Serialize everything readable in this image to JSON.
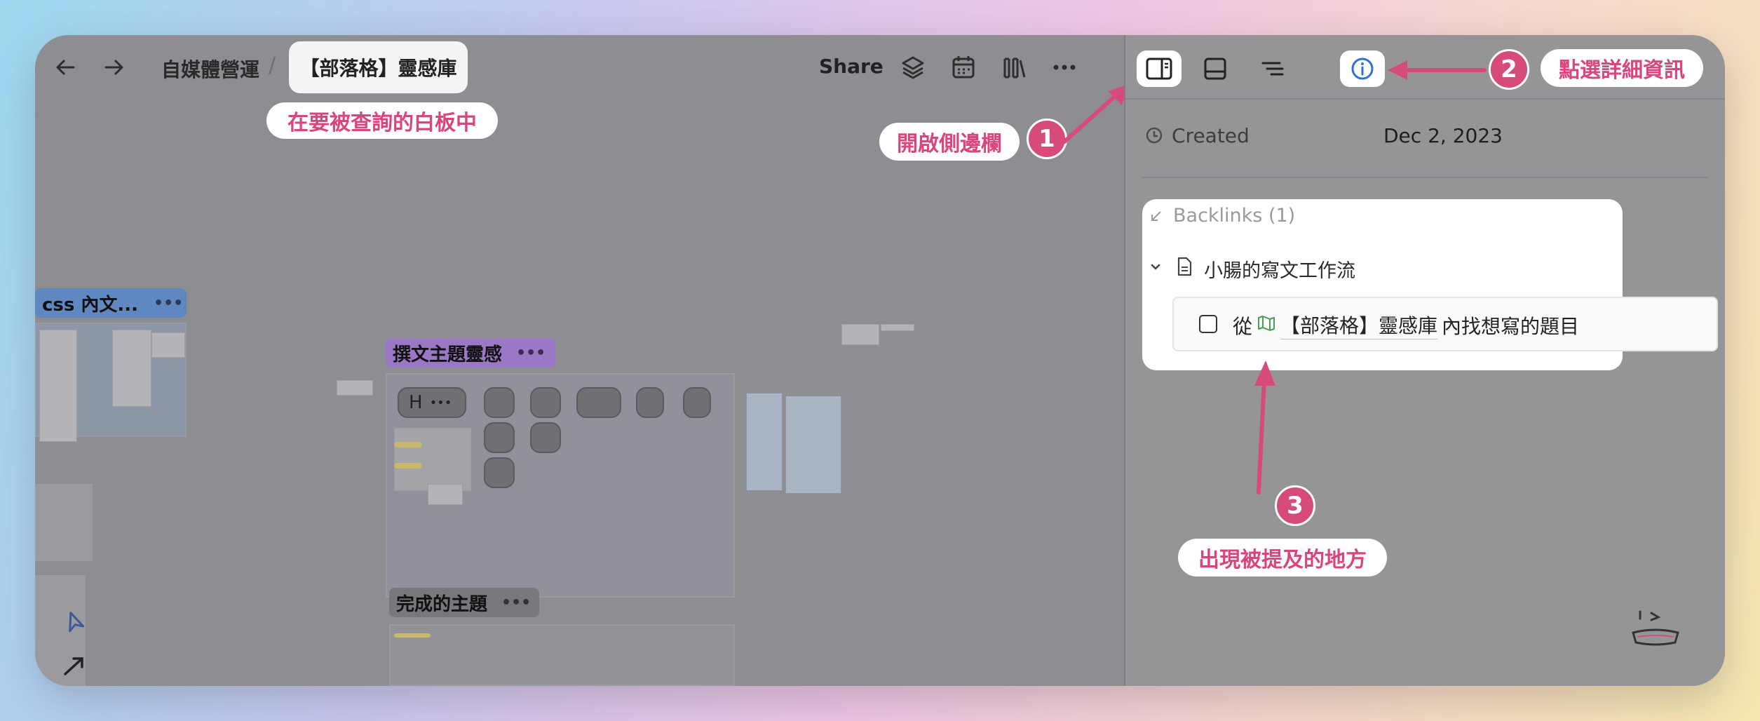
{
  "nav": {
    "back_icon": "arrow-left-icon",
    "forward_icon": "arrow-right-icon"
  },
  "breadcrumb": {
    "parent": "自媒體營運",
    "separator": "/",
    "current": "【部落格】靈感庫"
  },
  "toolbar": {
    "share_label": "Share",
    "icons": [
      "layers-icon",
      "calendar-icon",
      "library-icon",
      "more-icon"
    ]
  },
  "side_toolbar": {
    "icons": [
      "sidebar-toggle-icon",
      "panel-icon",
      "outline-icon",
      "info-icon"
    ]
  },
  "annotations": {
    "step1_number": "1",
    "step1_label": "開啟側邊欄",
    "step2_number": "2",
    "step2_label": "點選詳細資訊",
    "step3_number": "3",
    "step3_label": "出現被提及的地方",
    "whiteboard_hint": "在要被查詢的白板中",
    "accent_color": "#d64a7c"
  },
  "canvas": {
    "group1_label": "css 內文...",
    "group1_dots": "•••",
    "group2_label": "撰文主題靈感",
    "group2_dots": "•••",
    "group3_label": "完成的主題",
    "group3_dots": "•••",
    "node_letter": "H",
    "node_dots": "•••"
  },
  "details": {
    "created_label": "Created",
    "created_value": "Dec 2, 2023",
    "backlinks_label": "Backlinks (1)",
    "backlink_doc_title": "小腸的寫文工作流",
    "todo_prefix": "從",
    "todo_link_text": "【部落格】靈感庫",
    "todo_suffix": "內找想寫的題目"
  }
}
